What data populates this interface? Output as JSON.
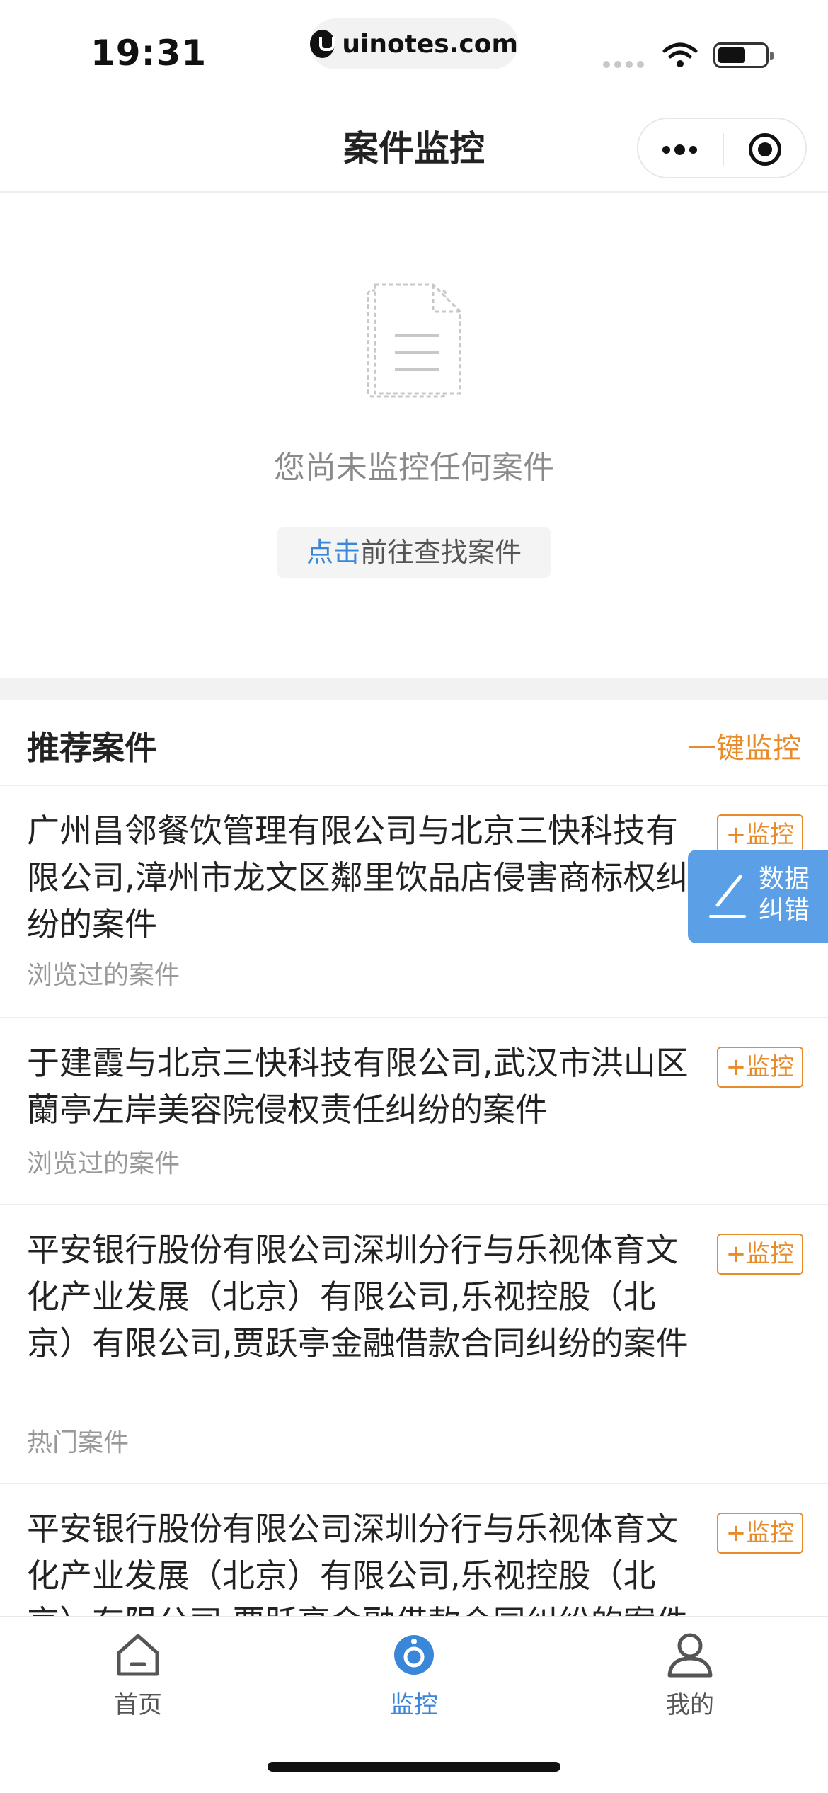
{
  "status_bar": {
    "time": "19:31",
    "url": "uinotes.com"
  },
  "nav": {
    "title": "案件监控"
  },
  "empty_state": {
    "message": "您尚未监控任何案件",
    "link_text": "点击",
    "button_rest": "前往查找案件"
  },
  "recommended": {
    "title": "推荐案件",
    "one_click": "一键监控"
  },
  "cases": [
    {
      "title": "广州昌邻餐饮管理有限公司与北京三快科技有限公司,漳州市龙文区鄰里饮品店侵害商标权纠纷的案件",
      "tag": "浏览过的案件",
      "button": "+监控"
    },
    {
      "title": "于建霞与北京三快科技有限公司,武汉市洪山区蘭亭左岸美容院侵权责任纠纷的案件",
      "tag": "浏览过的案件",
      "button": "+监控"
    },
    {
      "title": "平安银行股份有限公司深圳分行与乐视体育文化产业发展（北京）有限公司,乐视控股（北京）有限公司,贾跃亭金融借款合同纠纷的案件",
      "tag": "热门案件",
      "button": "+监控"
    },
    {
      "title": "平安银行股份有限公司深圳分行与乐视体育文化产业发展（北京）有限公司,乐视控股（北京）有限公司,贾跃亭金融借款合同纠纷的案件",
      "tag": "",
      "button": "+监控"
    }
  ],
  "float_button": {
    "line1": "数据",
    "line2": "纠错"
  },
  "tabs": [
    {
      "label": "首页",
      "icon": "home-icon",
      "active": false
    },
    {
      "label": "监控",
      "icon": "monitor-camera-icon",
      "active": true
    },
    {
      "label": "我的",
      "icon": "user-icon",
      "active": false
    }
  ],
  "colors": {
    "accent_blue": "#3a86d8",
    "accent_orange": "#e88b2a",
    "float_blue": "#5b9fe6"
  }
}
